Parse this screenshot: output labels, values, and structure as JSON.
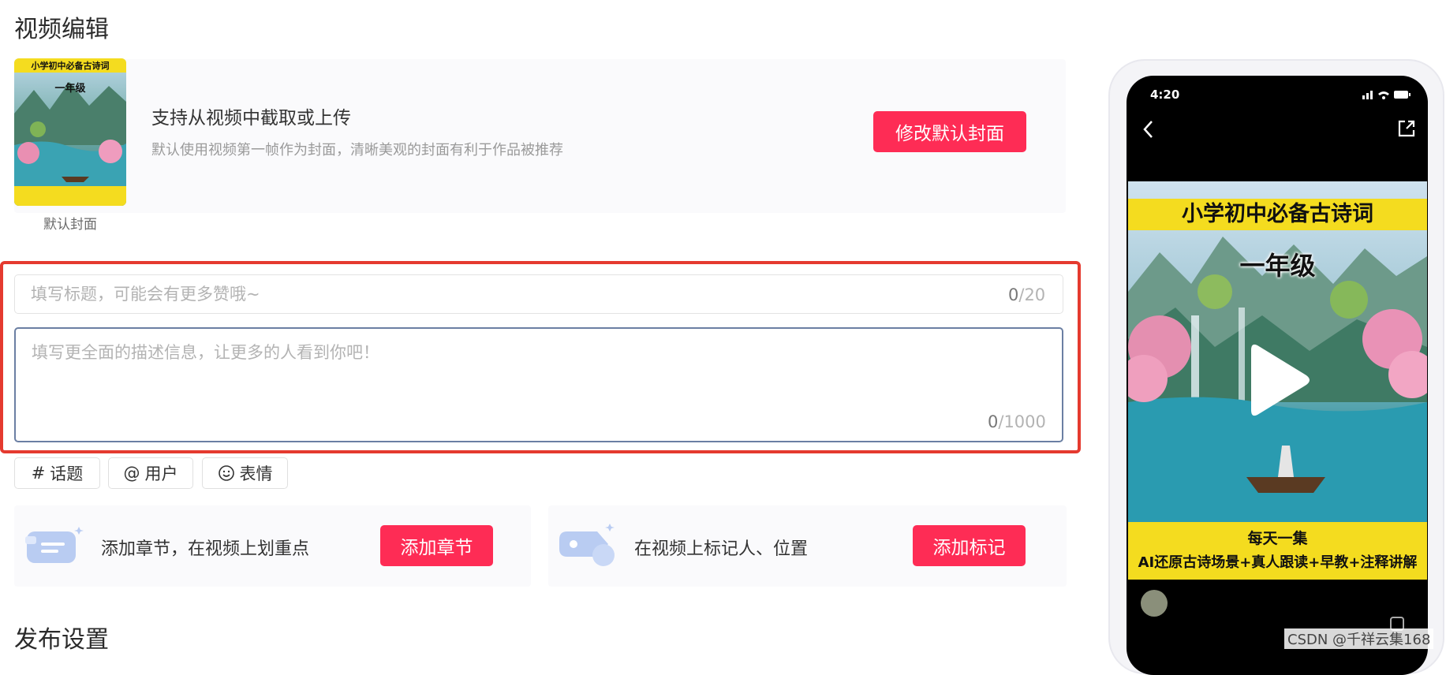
{
  "section": {
    "video_edit_title": "视频编辑",
    "publish_title": "发布设置"
  },
  "cover": {
    "caption": "默认封面",
    "main_text": "支持从视频中截取或上传",
    "sub_text": "默认使用视频第一帧作为封面，清晰美观的封面有利于作品被推荐",
    "change_button": "修改默认封面",
    "thumb_title": "小学初中必备古诗词",
    "thumb_grade": "一年级"
  },
  "form": {
    "title_placeholder": "填写标题，可能会有更多赞哦~",
    "title_count": "0",
    "title_limit": "/20",
    "desc_placeholder": "填写更全面的描述信息，让更多的人看到你吧！",
    "desc_count": "0",
    "desc_limit": "/1000"
  },
  "tags": [
    {
      "icon": "#",
      "label": "话题"
    },
    {
      "icon": "@",
      "label": "用户"
    },
    {
      "icon": "smile-icon",
      "label": "表情"
    }
  ],
  "chapter": {
    "text": "添加章节，在视频上划重点",
    "button": "添加章节"
  },
  "mark": {
    "text": "在视频上标记人、位置",
    "button": "添加标记"
  },
  "phone": {
    "time": "4:20",
    "video_title": "小学初中必备古诗词",
    "video_grade": "一年级",
    "video_bottom_line1": "每天一集",
    "video_bottom_line2": "AI还原古诗场景+真人跟读+早教+注释讲解"
  },
  "watermark": "CSDN @千祥云集168",
  "colors": {
    "accent": "#fe2c55",
    "highlight": "#e53a2f",
    "banner_yellow": "#f4dc1f"
  }
}
